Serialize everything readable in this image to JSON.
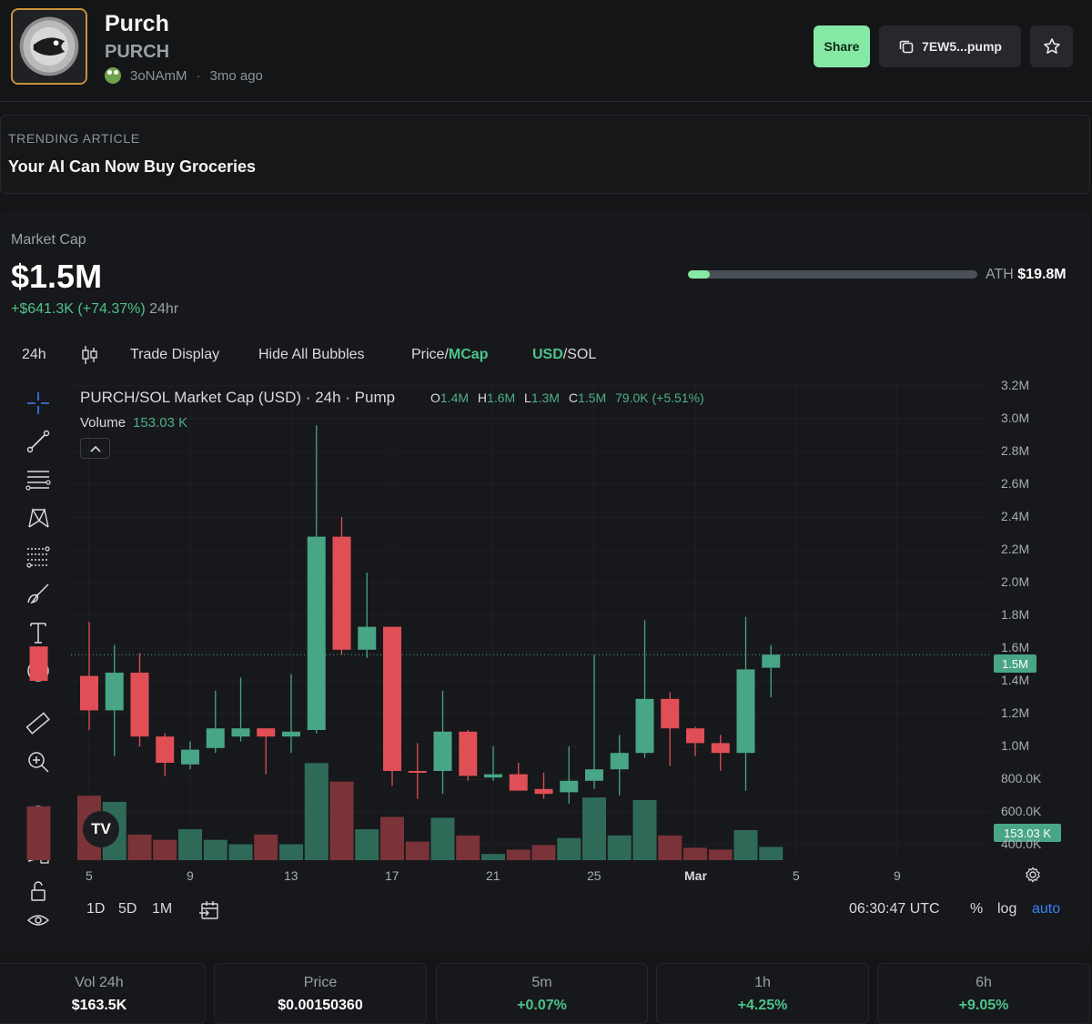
{
  "token": {
    "name": "Purch",
    "ticker": "PURCH",
    "creator": "3oNAmM",
    "age": "3mo ago"
  },
  "actions": {
    "share_label": "Share",
    "address_label": "7EW5...pump"
  },
  "trending": {
    "label": "TRENDING ARTICLE",
    "title": "Your AI Can Now Buy Groceries"
  },
  "market": {
    "label": "Market Cap",
    "value": "$1.5M",
    "change": "+$641.3K (+74.37%)",
    "change_period": "24hr",
    "ath_label": "ATH",
    "ath_value": "$19.8M",
    "ath_progress_fraction": 0.076
  },
  "toolbar": {
    "interval": "24h",
    "trade_display": "Trade Display",
    "hide_bubbles": "Hide All Bubbles",
    "price_label": "Price",
    "mcap_label": "MCap",
    "usd_label": "USD",
    "sol_label": "SOL",
    "slash": "/"
  },
  "chart_legend": {
    "title": "PURCH/SOL Market Cap (USD) · 24h · Pump",
    "o_label": "O",
    "o_value": "1.4M",
    "h_label": "H",
    "h_value": "1.6M",
    "l_label": "L",
    "l_value": "1.3M",
    "c_label": "C",
    "c_value": "1.5M",
    "change": "79.0K (+5.51%)",
    "volume_label": "Volume",
    "volume_value": "153.03 K",
    "tv_logo": "TV"
  },
  "chart_data": {
    "type": "candlestick",
    "title": "PURCH/SOL Market Cap (USD) · 24h · Pump",
    "colors": {
      "up": "#48a586",
      "down": "#e04f55",
      "vol_up": "#2f6a58",
      "vol_down": "#7a3338"
    },
    "y_ticks": [
      "3.2M",
      "3.0M",
      "2.8M",
      "2.6M",
      "2.4M",
      "2.2M",
      "2.0M",
      "1.8M",
      "1.6M",
      "1.4M",
      "1.2M",
      "1.0M",
      "800.0K",
      "600.0K",
      "400.0K"
    ],
    "ylim_millions": [
      0.4,
      3.2
    ],
    "x_ticks": [
      "5",
      "9",
      "13",
      "17",
      "21",
      "25",
      "Mar",
      "5",
      "9"
    ],
    "x_tick_days": [
      1,
      5,
      9,
      13,
      17,
      21,
      25,
      29,
      33
    ],
    "current_price_label": "1.5M",
    "current_volume_label": "153.03 K",
    "candles": [
      {
        "day": -1,
        "o": 1.61,
        "h": 1.61,
        "l": 1.4,
        "c": 1.4,
        "vol": 0.61
      },
      {
        "day": 1,
        "o": 1.43,
        "h": 1.76,
        "l": 1.1,
        "c": 1.22,
        "vol": 0.73
      },
      {
        "day": 2,
        "o": 1.22,
        "h": 1.62,
        "l": 0.94,
        "c": 1.45,
        "vol": 0.66
      },
      {
        "day": 3,
        "o": 1.45,
        "h": 1.57,
        "l": 1.0,
        "c": 1.06,
        "vol": 0.29
      },
      {
        "day": 4,
        "o": 1.06,
        "h": 1.08,
        "l": 0.82,
        "c": 0.9,
        "vol": 0.23
      },
      {
        "day": 5,
        "o": 0.89,
        "h": 1.03,
        "l": 0.86,
        "c": 0.98,
        "vol": 0.35
      },
      {
        "day": 6,
        "o": 0.99,
        "h": 1.34,
        "l": 0.96,
        "c": 1.11,
        "vol": 0.23
      },
      {
        "day": 7,
        "o": 1.06,
        "h": 1.42,
        "l": 1.03,
        "c": 1.11,
        "vol": 0.18
      },
      {
        "day": 8,
        "o": 1.11,
        "h": 1.11,
        "l": 0.83,
        "c": 1.06,
        "vol": 0.29
      },
      {
        "day": 9,
        "o": 1.06,
        "h": 1.44,
        "l": 0.96,
        "c": 1.09,
        "vol": 0.18
      },
      {
        "day": 10,
        "o": 1.1,
        "h": 2.96,
        "l": 1.08,
        "c": 2.28,
        "vol": 1.1
      },
      {
        "day": 11,
        "o": 2.28,
        "h": 2.4,
        "l": 1.56,
        "c": 1.59,
        "vol": 0.89
      },
      {
        "day": 12,
        "o": 1.59,
        "h": 2.06,
        "l": 1.54,
        "c": 1.73,
        "vol": 0.35
      },
      {
        "day": 13,
        "o": 1.73,
        "h": 1.73,
        "l": 0.76,
        "c": 0.85,
        "vol": 0.49
      },
      {
        "day": 14,
        "o": 0.85,
        "h": 1.02,
        "l": 0.68,
        "c": 0.84,
        "vol": 0.21
      },
      {
        "day": 15,
        "o": 0.85,
        "h": 1.34,
        "l": 0.71,
        "c": 1.09,
        "vol": 0.48
      },
      {
        "day": 16,
        "o": 1.09,
        "h": 1.1,
        "l": 0.79,
        "c": 0.82,
        "vol": 0.28
      },
      {
        "day": 17,
        "o": 0.81,
        "h": 1.0,
        "l": 0.79,
        "c": 0.83,
        "vol": 0.07
      },
      {
        "day": 18,
        "o": 0.83,
        "h": 0.9,
        "l": 0.73,
        "c": 0.73,
        "vol": 0.12
      },
      {
        "day": 19,
        "o": 0.74,
        "h": 0.84,
        "l": 0.68,
        "c": 0.71,
        "vol": 0.17
      },
      {
        "day": 20,
        "o": 0.72,
        "h": 1.0,
        "l": 0.65,
        "c": 0.79,
        "vol": 0.25
      },
      {
        "day": 21,
        "o": 0.79,
        "h": 1.56,
        "l": 0.74,
        "c": 0.86,
        "vol": 0.71
      },
      {
        "day": 22,
        "o": 0.86,
        "h": 1.07,
        "l": 0.7,
        "c": 0.96,
        "vol": 0.28
      },
      {
        "day": 23,
        "o": 0.96,
        "h": 1.77,
        "l": 0.93,
        "c": 1.29,
        "vol": 0.68
      },
      {
        "day": 24,
        "o": 1.29,
        "h": 1.33,
        "l": 0.88,
        "c": 1.11,
        "vol": 0.28
      },
      {
        "day": 25,
        "o": 1.11,
        "h": 1.12,
        "l": 0.94,
        "c": 1.02,
        "vol": 0.14
      },
      {
        "day": 26,
        "o": 1.02,
        "h": 1.07,
        "l": 0.85,
        "c": 0.96,
        "vol": 0.12
      },
      {
        "day": 27,
        "o": 0.96,
        "h": 1.79,
        "l": 0.73,
        "c": 1.47,
        "vol": 0.34
      },
      {
        "day": 28,
        "o": 1.48,
        "h": 1.62,
        "l": 1.3,
        "c": 1.56,
        "vol": 0.15
      }
    ]
  },
  "bottom": {
    "range_1d": "1D",
    "range_5d": "5D",
    "range_1m": "1M",
    "time": "06:30:47 UTC",
    "percent": "%",
    "log": "log",
    "auto": "auto"
  },
  "stats": [
    {
      "label": "Vol 24h",
      "value": "$163.5K",
      "positive": false
    },
    {
      "label": "Price",
      "value": "$0.00150360",
      "positive": false
    },
    {
      "label": "5m",
      "value": "+0.07%",
      "positive": true
    },
    {
      "label": "1h",
      "value": "+4.25%",
      "positive": true
    },
    {
      "label": "6h",
      "value": "+9.05%",
      "positive": true
    }
  ]
}
